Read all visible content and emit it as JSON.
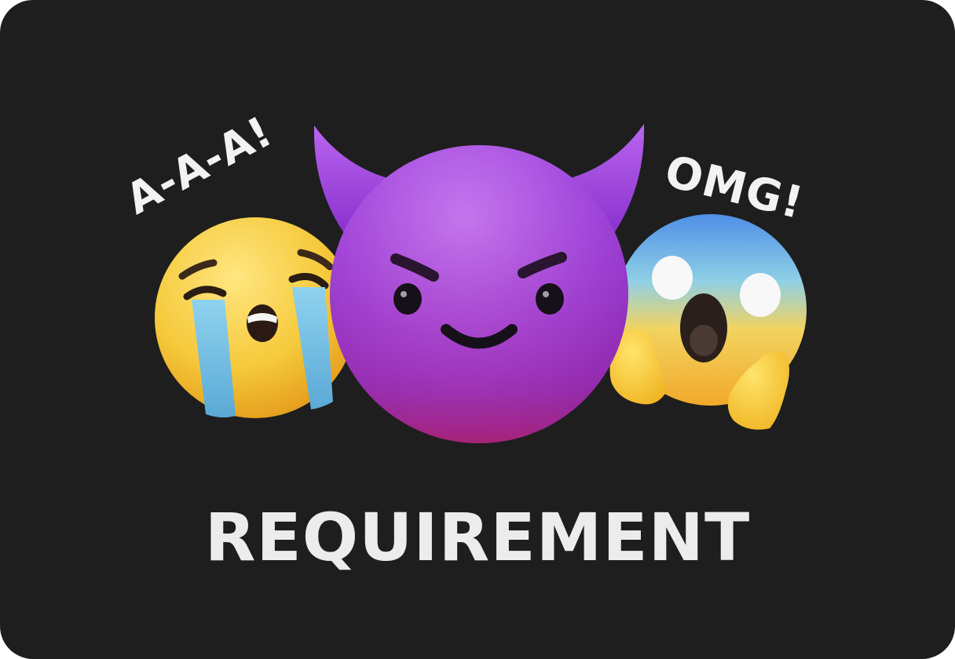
{
  "texts": {
    "left_exclaim": "A-A-A!",
    "right_exclaim": "OMG!",
    "caption": "REQUIREMENT"
  },
  "emojis": [
    {
      "name": "loudly-crying-face",
      "kind": "crying"
    },
    {
      "name": "smiling-face-with-horns",
      "kind": "devil"
    },
    {
      "name": "face-screaming-in-fear",
      "kind": "screaming"
    }
  ],
  "colors": {
    "background": "#1e1e1e",
    "text": "#ececec",
    "devil_purple": "#a84ee0",
    "crying_yellow": "#f5c93a",
    "tear_blue": "#7fc4e6",
    "scream_blue": "#5b9fe3"
  }
}
